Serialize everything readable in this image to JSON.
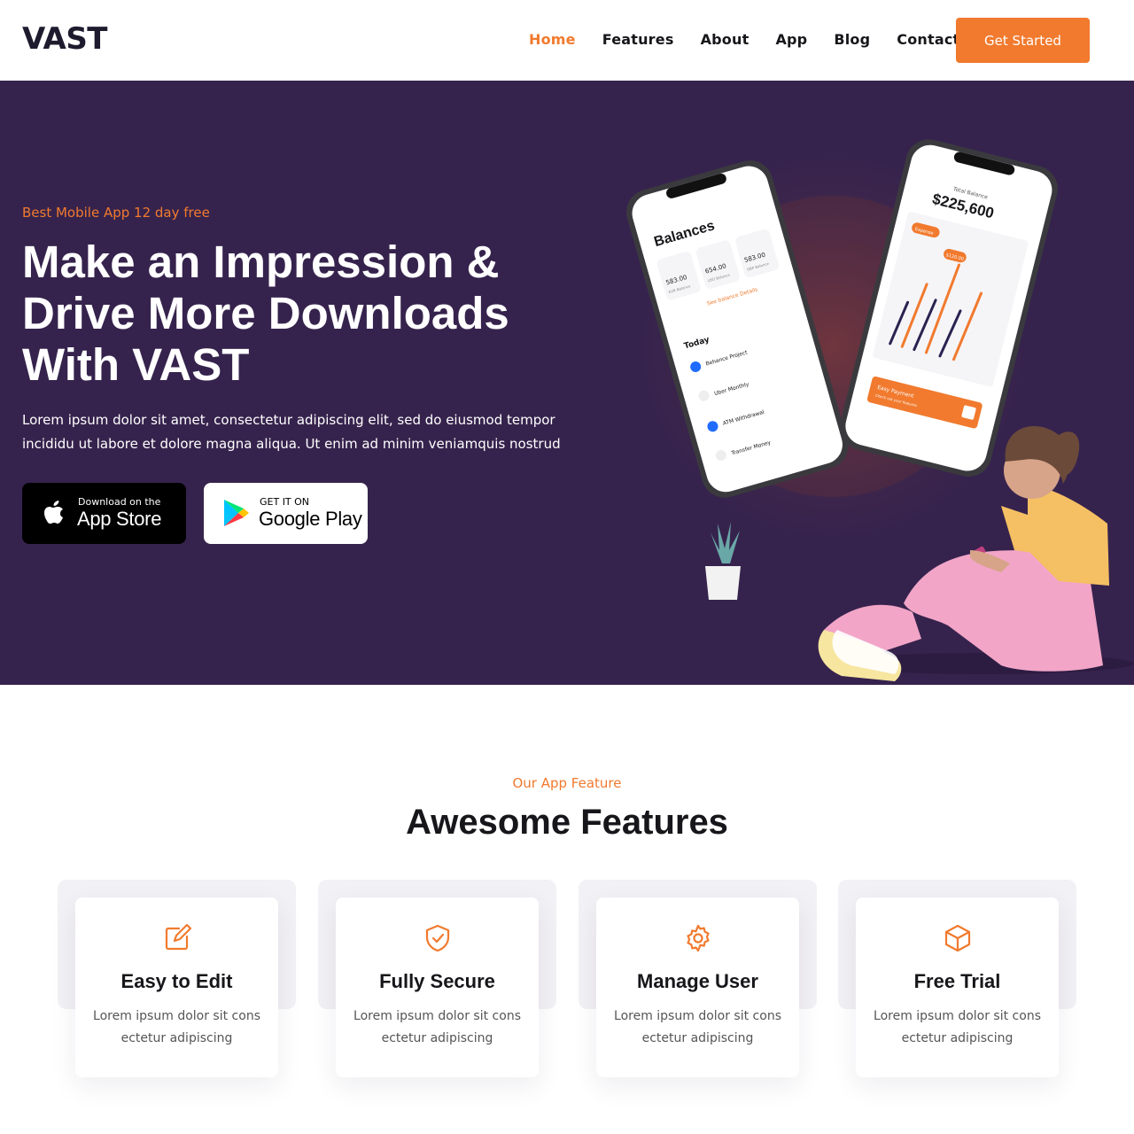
{
  "header": {
    "logo": "VAST",
    "nav": [
      {
        "label": "Home",
        "active": true
      },
      {
        "label": "Features"
      },
      {
        "label": "About"
      },
      {
        "label": "App"
      },
      {
        "label": "Blog"
      },
      {
        "label": "Contact"
      }
    ],
    "cta_label": "Get Started"
  },
  "hero": {
    "tagline": "Best Mobile App 12 day free",
    "title": "Make an Impression & Drive More Downloads With VAST",
    "description": "Lorem ipsum dolor sit amet, consectetur adipiscing elit, sed do eiusmod tempor incididu ut labore et dolore magna aliqua. Ut enim ad minim veniamquis nostrud",
    "app_store": {
      "small": "Download on the",
      "big": "App Store",
      "icon": "apple-icon"
    },
    "google_play": {
      "small": "GET IT ON",
      "big": "Google Play",
      "icon": "google-play-icon"
    },
    "phone_left": {
      "heading": "Balances",
      "balances": [
        "583.00",
        "654.00",
        "583.00"
      ],
      "currencies": [
        "EUR Balance",
        "USD Balance",
        "GBP Balance"
      ],
      "link": "See balance Details",
      "section": "Today",
      "transactions": [
        "Behance Project",
        "Uber Monthly",
        "ATM Withdrawal",
        "Transfer Money"
      ]
    },
    "phone_right": {
      "label": "Total Balance",
      "amount": "$225,600",
      "pill": "Expense",
      "bubble": "$120.00",
      "cta_title": "Easy Payment",
      "cta_sub": "Check out your features"
    }
  },
  "features": {
    "tag": "Our App Feature",
    "title": "Awesome Features",
    "items": [
      {
        "title": "Easy to Edit",
        "text": "Lorem ipsum dolor sit cons ectetur adipiscing",
        "icon": "edit-icon"
      },
      {
        "title": "Fully Secure",
        "text": "Lorem ipsum dolor sit cons ectetur adipiscing",
        "icon": "shield-check-icon"
      },
      {
        "title": "Manage User",
        "text": "Lorem ipsum dolor sit cons ectetur adipiscing",
        "icon": "gear-icon"
      },
      {
        "title": "Free Trial",
        "text": "Lorem ipsum dolor sit cons ectetur adipiscing",
        "icon": "box-icon"
      }
    ]
  },
  "colors": {
    "accent": "#f17a2e",
    "hero_bg": "#36234d",
    "dark": "#17161a"
  }
}
